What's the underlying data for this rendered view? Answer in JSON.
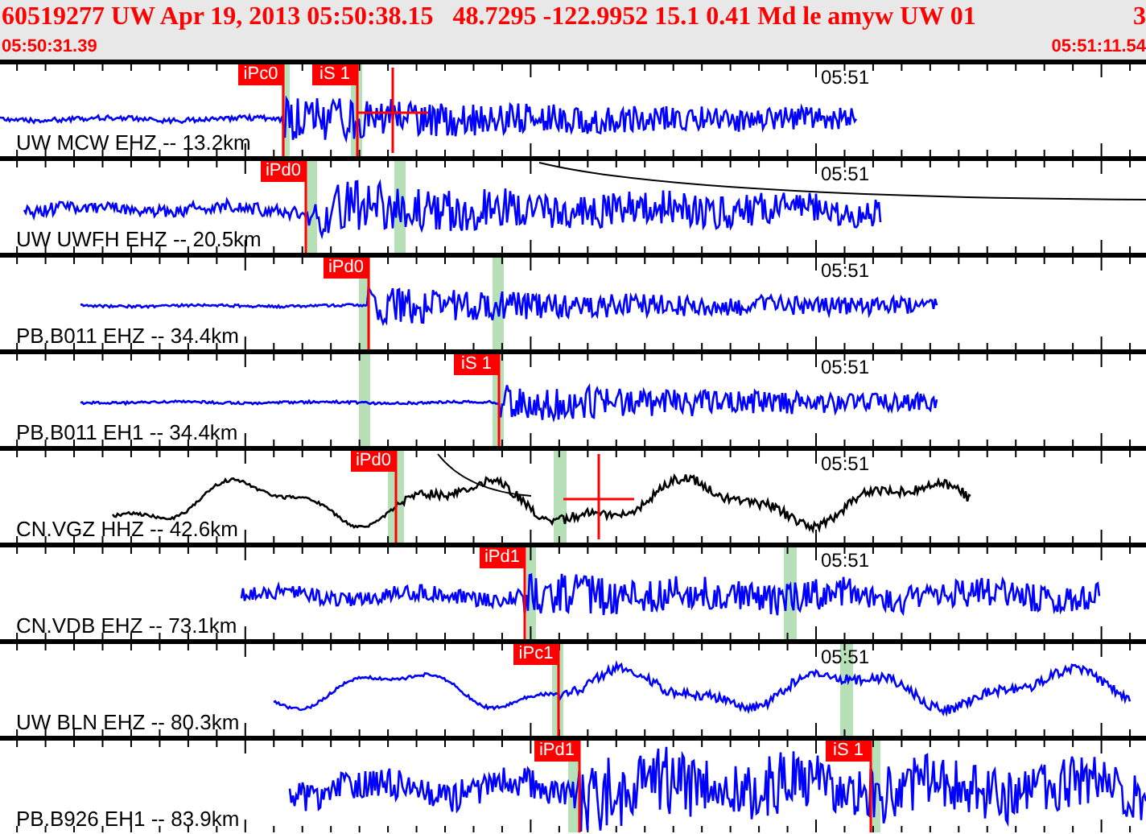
{
  "header": {
    "event": "60519277 UW Apr 19, 2013 05:50:38.15   48.7295 -122.9952 15.1 0.41 Md le amyw UW 01",
    "count": "3",
    "start_time": "05:50:31.39",
    "end_time": "05:51:11.54"
  },
  "traces": [
    {
      "channel": "UW MCW EHZ -- 13.2km",
      "time_mark": "05:51",
      "color": "#0000ff",
      "picks": [
        {
          "label": "iPc0"
        },
        {
          "label": "iS 1"
        }
      ]
    },
    {
      "channel": "UW UWFH EHZ -- 20.5km",
      "time_mark": "05:51",
      "color": "#0000ff",
      "picks": [
        {
          "label": "iPd0"
        }
      ]
    },
    {
      "channel": "PB.B011 EHZ -- 34.4km",
      "time_mark": "05:51",
      "color": "#0000ff",
      "picks": [
        {
          "label": "iPd0"
        }
      ]
    },
    {
      "channel": "PB.B011 EH1 -- 34.4km",
      "time_mark": "05:51",
      "color": "#0000ff",
      "picks": [
        {
          "label": "iS 1"
        }
      ]
    },
    {
      "channel": "CN.VGZ HHZ -- 42.6km",
      "time_mark": "05:51",
      "color": "#000000",
      "picks": [
        {
          "label": "iPd0"
        }
      ]
    },
    {
      "channel": "CN.VDB EHZ -- 73.1km",
      "time_mark": "05:51",
      "color": "#0000ff",
      "picks": [
        {
          "label": "iPd1"
        }
      ]
    },
    {
      "channel": "UW BLN EHZ -- 80.3km",
      "time_mark": "05:51",
      "color": "#0000ff",
      "picks": [
        {
          "label": "iPc1"
        }
      ]
    },
    {
      "channel": "PB.B926 EH1 -- 83.9km",
      "color": "#0000ff",
      "picks": [
        {
          "label": "iPd1"
        },
        {
          "label": "iS 1"
        }
      ]
    }
  ]
}
